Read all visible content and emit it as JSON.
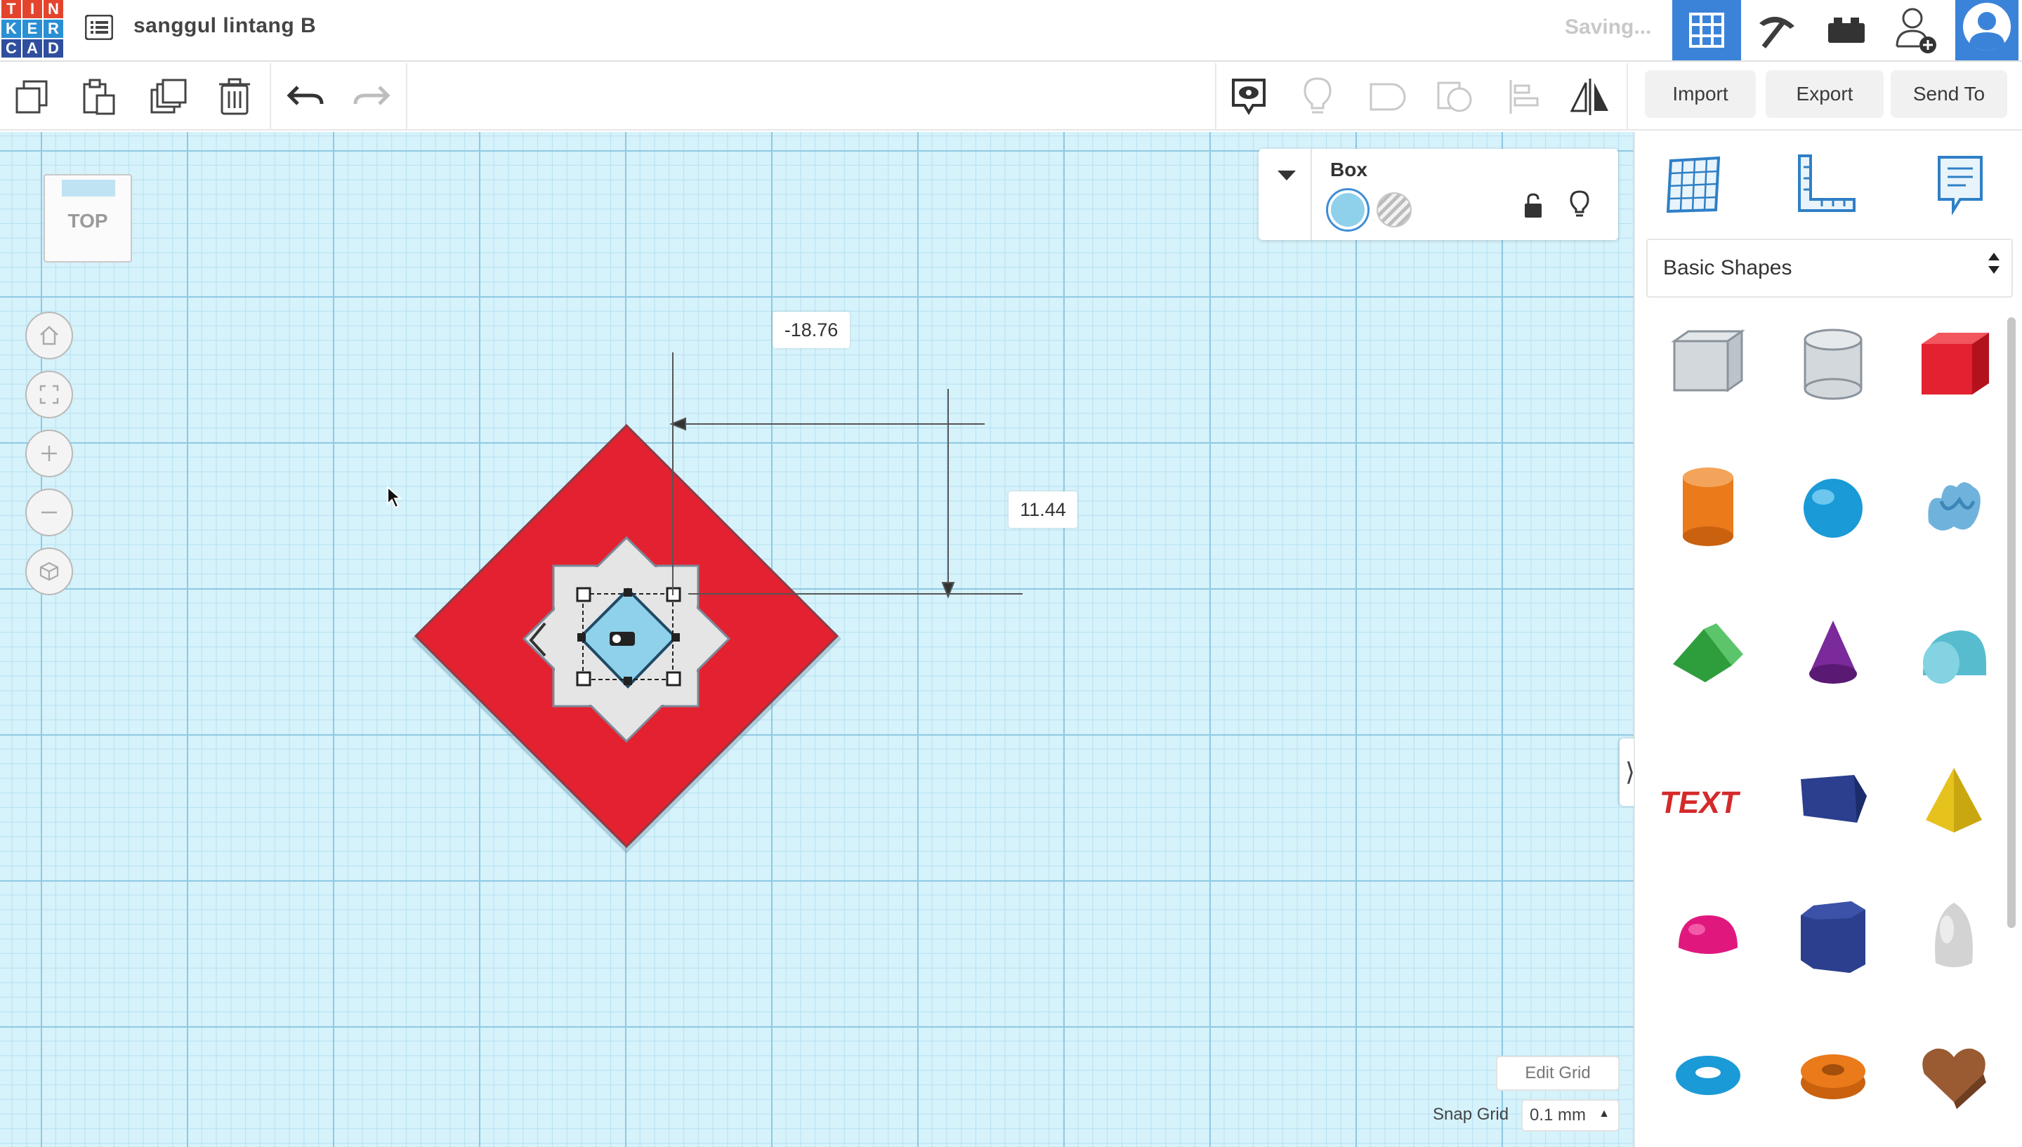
{
  "app": {
    "logo_letters": [
      "T",
      "I",
      "N",
      "K",
      "E",
      "R",
      "C",
      "A",
      "D"
    ],
    "logo_colors": [
      "#e4442d",
      "#e4442d",
      "#e4442d",
      "#2a8fd3",
      "#2a8fd3",
      "#2a8fd3",
      "#2f4f9e",
      "#2f4f9e",
      "#2f4f9e"
    ],
    "accent": "#3b83d9"
  },
  "header": {
    "project_title": "sanggul lintang B",
    "status": "Saving...",
    "icons": [
      "design-list-icon",
      "3d-design-grid-icon",
      "circuits-pickaxe-icon",
      "bricks-icon",
      "add-user-icon",
      "avatar-icon"
    ]
  },
  "toolbar": {
    "left_tools": [
      "copy",
      "paste",
      "duplicate",
      "delete",
      "undo",
      "redo"
    ],
    "right_tools": [
      "show-all",
      "light-bulb",
      "group",
      "ungroup",
      "align",
      "mirror"
    ],
    "import_label": "Import",
    "export_label": "Export",
    "send_to_label": "Send To"
  },
  "workplane": {
    "view_cube_label": "TOP",
    "nav_buttons": [
      "home",
      "fit-view",
      "zoom-in",
      "zoom-out",
      "perspective"
    ],
    "dimension_x": "-18.76",
    "dimension_y": "11.44",
    "edit_grid_label": "Edit Grid",
    "snap_grid_label": "Snap Grid",
    "snap_grid_value": "0.1 mm",
    "colors": {
      "red_shape": "#e32130",
      "selected_shape": "#8fd0ea",
      "hole": "#e5e5e5"
    }
  },
  "inspector": {
    "title": "Box",
    "solid_color": "#8fd0ea",
    "hole_label": "Hole"
  },
  "right_panel": {
    "library_icons": [
      "workplane-icon",
      "ruler-icon",
      "notes-icon"
    ],
    "category": "Basic Shapes",
    "shapes": [
      {
        "name": "box-hole",
        "color": "#c3c9cf"
      },
      {
        "name": "cylinder-hole",
        "color": "#c3c9cf"
      },
      {
        "name": "box",
        "color": "#e32130"
      },
      {
        "name": "cylinder",
        "color": "#ea7a1a"
      },
      {
        "name": "sphere",
        "color": "#1a9ad6"
      },
      {
        "name": "scribble",
        "color": "#6fb3dc"
      },
      {
        "name": "roof",
        "color": "#2e9e3c"
      },
      {
        "name": "cone",
        "color": "#7a2a9a"
      },
      {
        "name": "round-roof",
        "color": "#58bccf"
      },
      {
        "name": "text",
        "color": "#d42a2a"
      },
      {
        "name": "wedge",
        "color": "#2b3f8e"
      },
      {
        "name": "pyramid",
        "color": "#e6c21c"
      },
      {
        "name": "half-sphere",
        "color": "#e0187e"
      },
      {
        "name": "polygon",
        "color": "#2b3f8e"
      },
      {
        "name": "paraboloid",
        "color": "#d3d3d3"
      },
      {
        "name": "torus",
        "color": "#1a9ad6"
      },
      {
        "name": "tube",
        "color": "#ea7a1a"
      },
      {
        "name": "heart",
        "color": "#9a5a32"
      }
    ]
  }
}
